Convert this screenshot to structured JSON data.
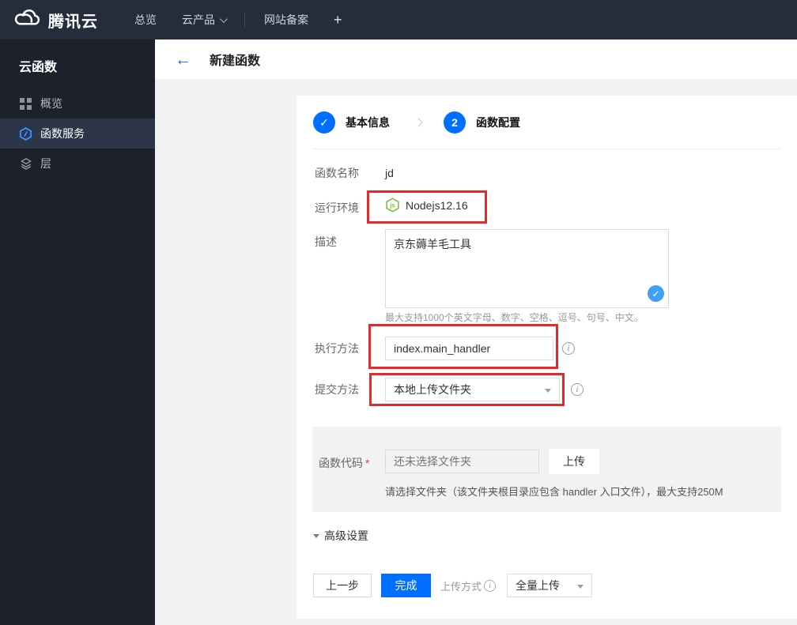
{
  "colors": {
    "primary_blue": "#006eff",
    "check_blue": "#41a0f3",
    "annotation_red": "#e62a2a",
    "node_green": "#7fbe42",
    "topbar_bg": "#252d3c",
    "sidebar_bg": "#1c212c",
    "sidebar_active_bg": "#2c3648",
    "content_bg": "#f2f2f2"
  },
  "icons": {
    "check": "✓",
    "back_arrow": "←",
    "info": "i",
    "node_js_text": "js",
    "plus": "+"
  },
  "topbar": {
    "brand": "腾讯云",
    "nav_overview": "总览",
    "nav_products": "云产品",
    "nav_icp": "网站备案"
  },
  "sidebar": {
    "title": "云函数",
    "items": [
      {
        "label": "概览"
      },
      {
        "label": "函数服务"
      },
      {
        "label": "层"
      }
    ]
  },
  "header": {
    "title": "新建函数"
  },
  "steps": {
    "step1_label": "基本信息",
    "step2_number": "2",
    "step2_label": "函数配置"
  },
  "form": {
    "name_label": "函数名称",
    "name_value": "jd",
    "runtime_label": "运行环境",
    "runtime_value": "Nodejs12.16",
    "desc_label": "描述",
    "desc_value": "京东薅羊毛工具",
    "desc_hint": "最大支持1000个英文字母、数字、空格、逗号、句号、中文。",
    "handler_label": "执行方法",
    "handler_value": "index.main_handler",
    "submit_label": "提交方法",
    "submit_value": "本地上传文件夹",
    "code_label": "函数代码",
    "code_required": "*",
    "code_placeholder": "还未选择文件夹",
    "upload_button": "上传",
    "code_hint": "请选择文件夹（该文件夹根目录应包含 handler 入口文件），最大支持250M",
    "advanced_label": "高级设置"
  },
  "footer": {
    "prev": "上一步",
    "finish": "完成",
    "upload_mode_label": "上传方式",
    "upload_mode_value": "全量上传"
  }
}
